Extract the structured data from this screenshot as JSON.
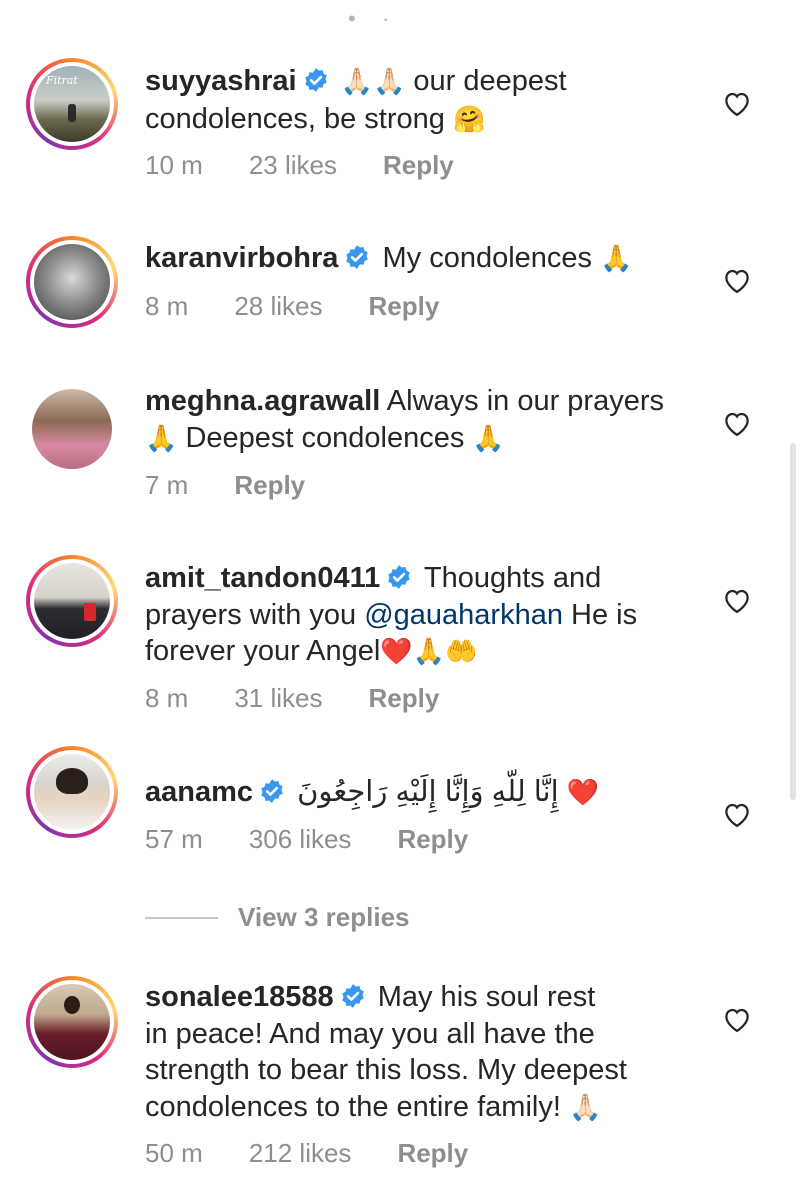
{
  "colors": {
    "verified": "#3897f0",
    "meta": "#8e8e8e",
    "mention": "#00376b",
    "text": "#262626"
  },
  "comments": [
    {
      "username": "suyyashrai",
      "verified": true,
      "avatar_caption": "Fitrat",
      "body_line1": "our deepest",
      "body_line2": "condolences, be strong",
      "emoji_a": "🙏🏻🙏🏻",
      "emoji_b": "🤗",
      "time": "10 m",
      "likes": "23 likes",
      "reply": "Reply"
    },
    {
      "username": "karanvirbohra",
      "verified": true,
      "body": "My condolences",
      "emoji_a": "🙏",
      "time": "8 m",
      "likes": "28 likes",
      "reply": "Reply"
    },
    {
      "username": "meghna.agrawall",
      "verified": false,
      "body_line1": "Always in our prayers",
      "body_line2": "Deepest condolences",
      "emoji_a": "🙏",
      "emoji_b": "🙏",
      "time": "7 m",
      "reply": "Reply"
    },
    {
      "username": "amit_tandon0411",
      "verified": true,
      "body_line1": "Thoughts and",
      "body_line2a": "prayers with you",
      "mention": "@gauaharkhan",
      "body_line2b": "He is",
      "body_line3": "forever your Angel",
      "emoji_a": "❤️🙏🤲",
      "time": "8 m",
      "likes": "31 likes",
      "reply": "Reply"
    },
    {
      "username": "aanamc",
      "verified": true,
      "body": "إِنَّا لِلّهِ وَإِنَّا إِلَيْهِ رَاجِعُونَ",
      "emoji_a": "❤️",
      "time": "57 m",
      "likes": "306 likes",
      "reply": "Reply",
      "view_replies": "View 3 replies"
    },
    {
      "username": "sonalee18588",
      "verified": true,
      "body_line1": "May his soul rest",
      "body_line2": "in peace! And may you all have the",
      "body_line3": "strength to bear this loss. My deepest",
      "body_line4": "condolences to the entire family!",
      "emoji_a": "🙏🏻",
      "time": "50 m",
      "likes": "212 likes",
      "reply": "Reply"
    }
  ],
  "icons": {
    "like": "heart-outline-icon",
    "verified": "verified-badge-icon"
  }
}
